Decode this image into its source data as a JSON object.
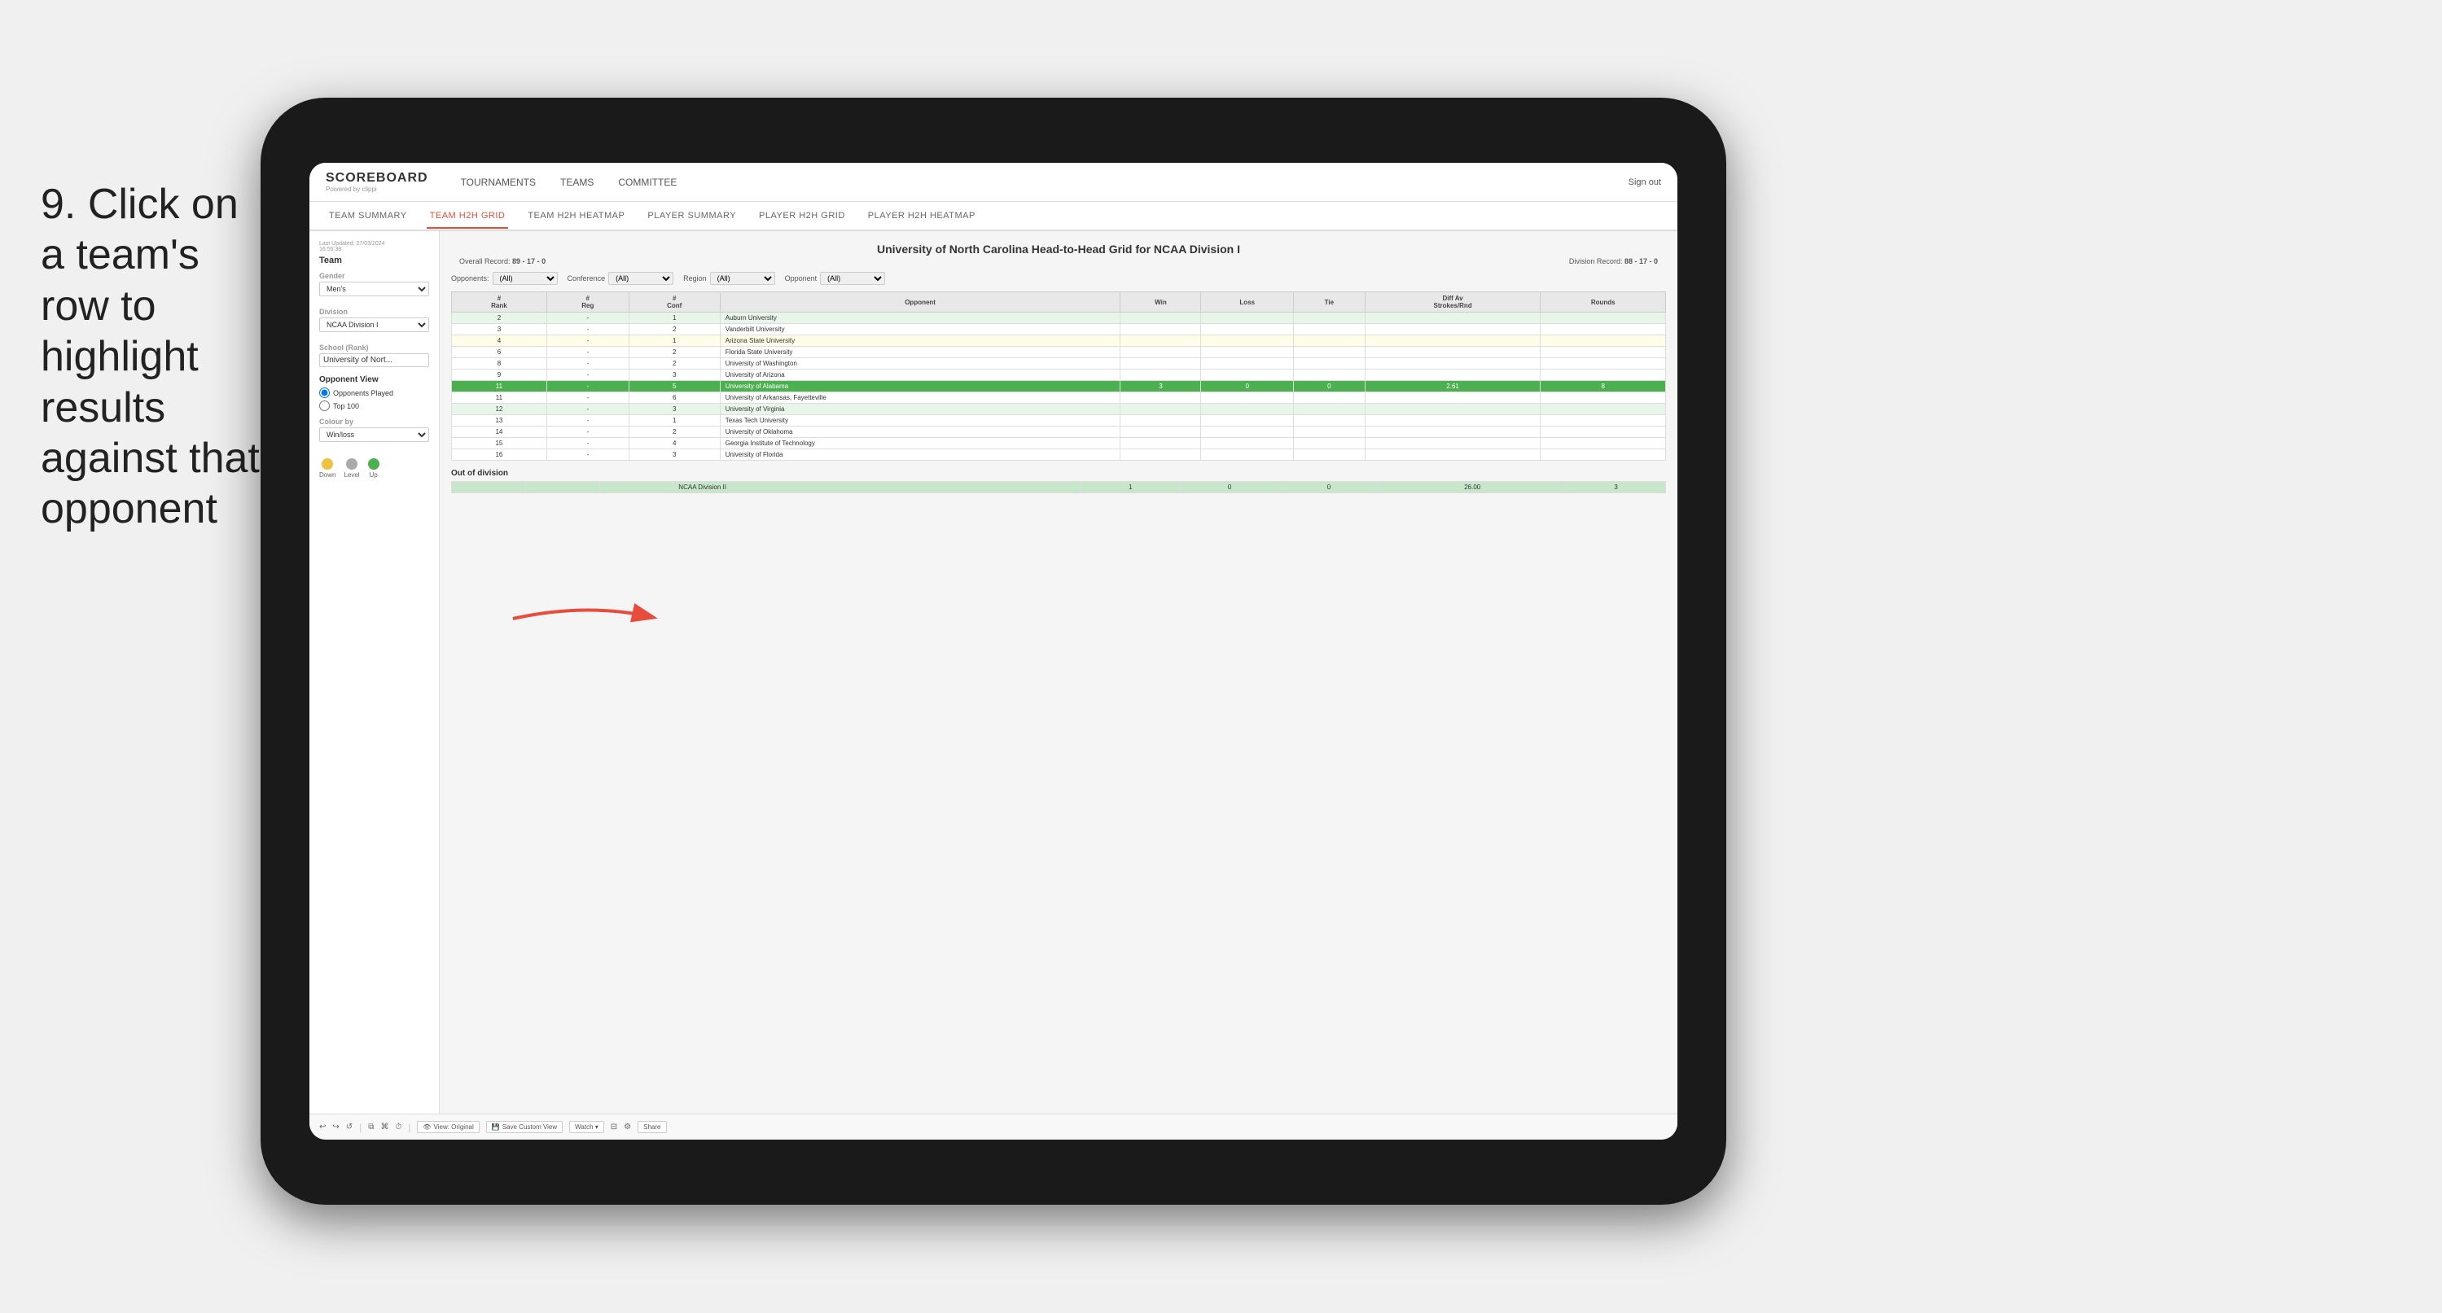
{
  "instruction": {
    "step": "9.",
    "text": "Click on a team's row to highlight results against that opponent"
  },
  "nav": {
    "logo": "SCOREBOARD",
    "logo_sub": "Powered by clippi",
    "items": [
      "TOURNAMENTS",
      "TEAMS",
      "COMMITTEE"
    ],
    "sign_out": "Sign out"
  },
  "sub_nav": {
    "items": [
      "TEAM SUMMARY",
      "TEAM H2H GRID",
      "TEAM H2H HEATMAP",
      "PLAYER SUMMARY",
      "PLAYER H2H GRID",
      "PLAYER H2H HEATMAP"
    ],
    "active": "TEAM H2H GRID"
  },
  "sidebar": {
    "last_updated_label": "Last Updated: 27/03/2024",
    "last_updated_time": "16:55:38",
    "team_label": "Team",
    "gender_label": "Gender",
    "gender_value": "Men's",
    "division_label": "Division",
    "division_value": "NCAA Division I",
    "school_label": "School (Rank)",
    "school_value": "University of Nort...",
    "opponent_view_label": "Opponent View",
    "radio_opponents": "Opponents Played",
    "radio_top100": "Top 100",
    "colour_by_label": "Colour by",
    "colour_by_value": "Win/loss",
    "legend": {
      "down_label": "Down",
      "level_label": "Level",
      "up_label": "Up"
    }
  },
  "main": {
    "title": "University of North Carolina Head-to-Head Grid for NCAA Division I",
    "overall_record_label": "Overall Record:",
    "overall_record": "89 - 17 - 0",
    "division_record_label": "Division Record:",
    "division_record": "88 - 17 - 0",
    "filters": {
      "opponents_label": "Opponents:",
      "opponents_value": "(All)",
      "conference_label": "Conference",
      "conference_value": "(All)",
      "region_label": "Region",
      "region_value": "(All)",
      "opponent_label": "Opponent",
      "opponent_value": "(All)"
    },
    "table": {
      "headers": [
        "#\nRank",
        "#\nReg",
        "#\nConf",
        "Opponent",
        "Win",
        "Loss",
        "Tie",
        "Diff Av\nStrokes/Rnd",
        "Rounds"
      ],
      "rows": [
        {
          "rank": "2",
          "reg": "-",
          "conf": "1",
          "opponent": "Auburn University",
          "win": "",
          "loss": "",
          "tie": "",
          "diff": "",
          "rounds": "",
          "style": "light-green"
        },
        {
          "rank": "3",
          "reg": "-",
          "conf": "2",
          "opponent": "Vanderbilt University",
          "win": "",
          "loss": "",
          "tie": "",
          "diff": "",
          "rounds": "",
          "style": "white"
        },
        {
          "rank": "4",
          "reg": "-",
          "conf": "1",
          "opponent": "Arizona State University",
          "win": "",
          "loss": "",
          "tie": "",
          "diff": "",
          "rounds": "",
          "style": "light-yellow"
        },
        {
          "rank": "6",
          "reg": "-",
          "conf": "2",
          "opponent": "Florida State University",
          "win": "",
          "loss": "",
          "tie": "",
          "diff": "",
          "rounds": "",
          "style": "white"
        },
        {
          "rank": "8",
          "reg": "-",
          "conf": "2",
          "opponent": "University of Washington",
          "win": "",
          "loss": "",
          "tie": "",
          "diff": "",
          "rounds": "",
          "style": "white"
        },
        {
          "rank": "9",
          "reg": "-",
          "conf": "3",
          "opponent": "University of Arizona",
          "win": "",
          "loss": "",
          "tie": "",
          "diff": "",
          "rounds": "",
          "style": "white"
        },
        {
          "rank": "11",
          "reg": "-",
          "conf": "5",
          "opponent": "University of Alabama",
          "win": "3",
          "loss": "0",
          "tie": "0",
          "diff": "2.61",
          "rounds": "8",
          "style": "highlighted"
        },
        {
          "rank": "11",
          "reg": "-",
          "conf": "6",
          "opponent": "University of Arkansas, Fayetteville",
          "win": "",
          "loss": "",
          "tie": "",
          "diff": "",
          "rounds": "",
          "style": "white"
        },
        {
          "rank": "12",
          "reg": "-",
          "conf": "3",
          "opponent": "University of Virginia",
          "win": "",
          "loss": "",
          "tie": "",
          "diff": "",
          "rounds": "",
          "style": "light-green"
        },
        {
          "rank": "13",
          "reg": "-",
          "conf": "1",
          "opponent": "Texas Tech University",
          "win": "",
          "loss": "",
          "tie": "",
          "diff": "",
          "rounds": "",
          "style": "white"
        },
        {
          "rank": "14",
          "reg": "-",
          "conf": "2",
          "opponent": "University of Oklahoma",
          "win": "",
          "loss": "",
          "tie": "",
          "diff": "",
          "rounds": "",
          "style": "white"
        },
        {
          "rank": "15",
          "reg": "-",
          "conf": "4",
          "opponent": "Georgia Institute of Technology",
          "win": "",
          "loss": "",
          "tie": "",
          "diff": "",
          "rounds": "",
          "style": "white"
        },
        {
          "rank": "16",
          "reg": "-",
          "conf": "3",
          "opponent": "University of Florida",
          "win": "",
          "loss": "",
          "tie": "",
          "diff": "",
          "rounds": "",
          "style": "white"
        }
      ]
    },
    "out_of_division": {
      "title": "Out of division",
      "row": {
        "division": "NCAA Division II",
        "win": "1",
        "loss": "0",
        "tie": "0",
        "diff": "26.00",
        "rounds": "3"
      }
    }
  },
  "toolbar": {
    "undo": "↩",
    "redo": "↪",
    "revert": "↺",
    "copy": "⧉",
    "paste": "⌘",
    "history": "⏱",
    "view_original": "View: Original",
    "save_custom": "Save Custom View",
    "watch": "Watch ▾",
    "present": "⊟",
    "settings": "⚙",
    "share": "Share"
  },
  "colors": {
    "highlighted_row": "#4caf50",
    "light_green": "#e8f5e9",
    "light_yellow": "#fffde7",
    "out_of_div_green": "#c8e6c9",
    "active_tab": "#e74c3c",
    "legend_down": "#f0c040",
    "legend_level": "#aaaaaa",
    "legend_up": "#4caf50"
  }
}
